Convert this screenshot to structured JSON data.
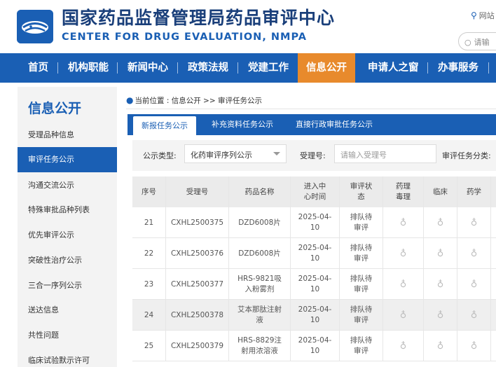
{
  "header": {
    "title_cn": "国家药品监督管理局药品审评中心",
    "title_en": "CENTER FOR DRUG EVALUATION, NMPA",
    "site_link": "网站",
    "search_placeholder": "请输"
  },
  "nav": {
    "items": [
      "首页",
      "机构职能",
      "新闻中心",
      "政策法规",
      "党建工作",
      "信息公开",
      "申请人之窗",
      "办事服务"
    ],
    "active": "信息公开"
  },
  "sidebar": {
    "title": "信息公开",
    "items": [
      "受理品种信息",
      "审评任务公示",
      "沟通交流公示",
      "特殊审批品种列表",
      "优先审评公示",
      "突破性治疗公示",
      "三合一序列公示",
      "送达信息",
      "共性问题",
      "临床试验默示许可"
    ],
    "active": "审评任务公示"
  },
  "breadcrumb": {
    "text": "当前位置 : 信息公开 >> 审评任务公示"
  },
  "tabs": {
    "items": [
      "新报任务公示",
      "补充资料任务公示",
      "直接行政审批任务公示"
    ],
    "active": "新报任务公示"
  },
  "filter": {
    "type_label": "公示类型:",
    "type_value": "化药审评序列公示",
    "accept_label": "受理号:",
    "accept_placeholder": "请输入受理号",
    "category_label": "审评任务分类:"
  },
  "table": {
    "headers": [
      "序号",
      "受理号",
      "药品名称",
      "进入中心时间",
      "审评状态",
      "药理毒理",
      "临床",
      "药学"
    ],
    "rows": [
      {
        "no": "21",
        "accept": "CXHL2500375",
        "name": "DZD6008片",
        "date": "2025-04-10",
        "status": "排队待审评"
      },
      {
        "no": "22",
        "accept": "CXHL2500376",
        "name": "DZD6008片",
        "date": "2025-04-10",
        "status": "排队待审评"
      },
      {
        "no": "23",
        "accept": "CXHL2500377",
        "name": "HRS-9821吸入粉雾剂",
        "date": "2025-04-10",
        "status": "排队待审评"
      },
      {
        "no": "24",
        "accept": "CXHL2500378",
        "name": "艾本那肽注射液",
        "date": "2025-04-10",
        "status": "排队待审评"
      },
      {
        "no": "25",
        "accept": "CXHL2500379",
        "name": "HRS-8829注射用浓溶液",
        "date": "2025-04-10",
        "status": "排队待审评"
      }
    ],
    "bulb_icon": "lightbulb-icon"
  },
  "colors": {
    "primary": "#1a5fb4",
    "accent": "#e88a2c",
    "title": "#1a3f7a"
  }
}
